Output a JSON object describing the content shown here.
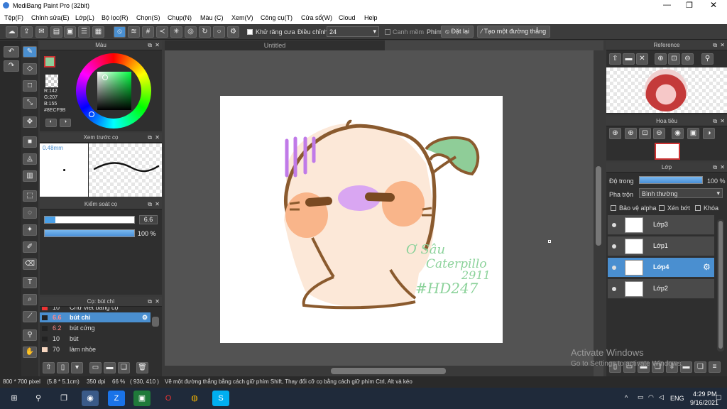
{
  "window": {
    "title": "MediBang Paint Pro (32bit)"
  },
  "menu": [
    "Tệp(F)",
    "Chỉnh sửa(E)",
    "Lớp(L)",
    "Bộ lọc(R)",
    "Chọn(S)",
    "Chụp(N)",
    "Màu (C)",
    "Xem(V)",
    "Công cụ(T)",
    "Cửa sổ(W)",
    "Cloud",
    "Help"
  ],
  "toolbar": {
    "antialias": "Khử răng cưa",
    "adjust": "Điều chỉnh",
    "adjust_value": "24",
    "smooth": "Canh mềm",
    "phim": "Phím",
    "reset": "Đặt lại",
    "straight": "Tạo một đường thẳng"
  },
  "color_panel": {
    "title": "Màu",
    "r": "R:142",
    "g": "G:207",
    "b": "B:155",
    "hex": "#8ECF9B",
    "color": "#8ECF9B"
  },
  "brush_preview": {
    "title": "Xem trước cọ",
    "size": "0.48mm"
  },
  "brush_control": {
    "title": "Kiểm soát cọ",
    "size": "6.6",
    "opacity": "100 %",
    "opacity_value": 100
  },
  "brush_list": {
    "title": "Cọ: bút chì",
    "items": [
      {
        "size": "10",
        "name": "Chữ viết bằng cọ"
      },
      {
        "size": "6.6",
        "name": "bút chì"
      },
      {
        "size": "6.2",
        "name": "bút cứng"
      },
      {
        "size": "10",
        "name": "bút"
      },
      {
        "size": "70",
        "name": "làm nhòe"
      }
    ]
  },
  "canvas": {
    "tab": "Untitled"
  },
  "sign": {
    "l1": "Ơ Sâu",
    "l2": "Caterpillo",
    "l3": "2911",
    "l4": "#HD247"
  },
  "reference": {
    "title": "Reference"
  },
  "navigator": {
    "title": "Hoa tiêu"
  },
  "layers": {
    "title": "Lớp",
    "opacity_label": "Độ trong",
    "opacity": "100 %",
    "opacity_value": 100,
    "blend_label": "Pha trộn",
    "blend": "Bình thường",
    "protect": "Bảo vệ alpha",
    "clip": "Xén bớt",
    "lock": "Khóa",
    "items": [
      "Lớp3",
      "Lớp1",
      "Lớp4",
      "Lớp2"
    ]
  },
  "status": {
    "size": "800 * 700 pixel",
    "cm": "(5.8 * 5.1cm)",
    "dpi": "350 dpi",
    "zoom": "66 %",
    "coords": "( 930, 410 )",
    "hint": "Vẽ một đường thẳng bằng cách giữ phím Shift, Thay đổi cỡ cọ bằng cách giữ phím Ctrl, Alt và kéo"
  },
  "watermark": {
    "l1": "Activate Windows",
    "l2": "Go to Settings to activate Windows."
  },
  "taskbar": {
    "lang": "ENG",
    "time": "4:29 PM",
    "date": "9/16/2021"
  }
}
